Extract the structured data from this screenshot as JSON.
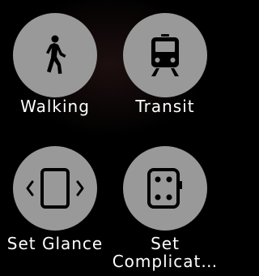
{
  "colors": {
    "background": "#000000",
    "tile": "#999999",
    "icon": "#000000",
    "label": "#ffffff"
  },
  "items": [
    {
      "label": "Walking",
      "icon": "walking-person-icon"
    },
    {
      "label": "Transit",
      "icon": "train-icon"
    },
    {
      "label": "Set Glance",
      "icon": "glance-swipe-icon"
    },
    {
      "label_line1": "Set",
      "label_line2": "Complicat…",
      "icon": "watch-face-icon"
    }
  ]
}
